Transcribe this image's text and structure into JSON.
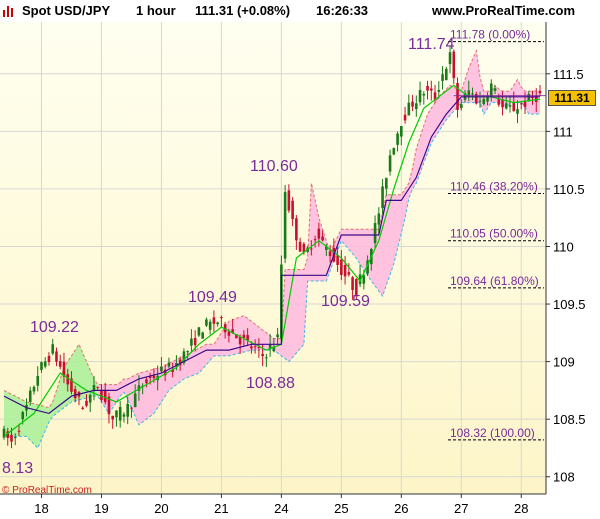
{
  "header": {
    "instrument": "Spot USD/JPY",
    "timeframe": "1 hour",
    "price_change": "111.31 (+0.08%)",
    "time": "16:26:33",
    "site": "www.ProRealTime.com"
  },
  "last_price_label": "111.31",
  "copyright": "© ProRealTime.com",
  "colors": {
    "plot_background_top": "#fffff0",
    "plot_background_bottom": "#fdf5c8",
    "candle_up": "#1a7a1a",
    "candle_down": "#c8102e",
    "fast_line": "#00cc00",
    "slow_line": "#3a0a8a",
    "cloud_bearish": "#ffb8e0",
    "cloud_bullish": "#a8f098",
    "annotation": "#7a2a9a",
    "last_price_box": "#f5c000"
  },
  "chart_data": {
    "type": "candlestick",
    "x_axis": {
      "tick_labels": [
        "18",
        "19",
        "20",
        "21",
        "24",
        "25",
        "26",
        "27",
        "28"
      ]
    },
    "y_axis": {
      "tick_labels": [
        "111.5",
        "111",
        "110.5",
        "110",
        "109.5",
        "109",
        "108.5",
        "108"
      ],
      "range": [
        107.85,
        111.95
      ]
    },
    "grid": true,
    "price_labels": [
      "109.22",
      "109.49",
      "108.88",
      "110.60",
      "109.59",
      "111.74",
      "8.13"
    ],
    "fibonacci_levels": [
      {
        "value": 111.78,
        "label": "111.78 (0.00%)"
      },
      {
        "value": 110.46,
        "label": "110.46 (38.20%)"
      },
      {
        "value": 110.05,
        "label": "110.05 (50.00%)"
      },
      {
        "value": 109.64,
        "label": "109.64 (61.80%)"
      },
      {
        "value": 108.32,
        "label": "108.32 (100.00)"
      }
    ],
    "price_path": [
      [
        0,
        108.4
      ],
      [
        3,
        108.3
      ],
      [
        7,
        108.6
      ],
      [
        10,
        108.9
      ],
      [
        14,
        109.1
      ],
      [
        18,
        108.8
      ],
      [
        22,
        108.6
      ],
      [
        26,
        108.8
      ],
      [
        30,
        108.5
      ],
      [
        34,
        108.6
      ],
      [
        38,
        108.8
      ],
      [
        42,
        108.9
      ],
      [
        46,
        108.95
      ],
      [
        50,
        109.1
      ],
      [
        54,
        109.3
      ],
      [
        58,
        109.35
      ],
      [
        62,
        109.25
      ],
      [
        66,
        109.15
      ],
      [
        70,
        109.05
      ],
      [
        74,
        109.2
      ],
      [
        76,
        110.5
      ],
      [
        78,
        110.2
      ],
      [
        81,
        109.9
      ],
      [
        84,
        110.1
      ],
      [
        88,
        109.95
      ],
      [
        92,
        109.75
      ],
      [
        95,
        109.62
      ],
      [
        98,
        109.9
      ],
      [
        101,
        110.3
      ],
      [
        104,
        110.8
      ],
      [
        107,
        111.1
      ],
      [
        110,
        111.25
      ],
      [
        113,
        111.35
      ],
      [
        116,
        111.3
      ],
      [
        118,
        111.5
      ],
      [
        120,
        111.65
      ],
      [
        122,
        111.2
      ],
      [
        125,
        111.35
      ],
      [
        128,
        111.25
      ],
      [
        131,
        111.4
      ],
      [
        134,
        111.2
      ],
      [
        137,
        111.2
      ],
      [
        140,
        111.25
      ],
      [
        143,
        111.31
      ]
    ],
    "series": [
      {
        "points": [
          [
            0,
            108.35
          ],
          [
            8,
            108.55
          ],
          [
            15,
            108.9
          ],
          [
            22,
            108.75
          ],
          [
            30,
            108.65
          ],
          [
            38,
            108.8
          ],
          [
            46,
            108.95
          ],
          [
            52,
            109.15
          ],
          [
            58,
            109.3
          ],
          [
            64,
            109.2
          ],
          [
            70,
            109.1
          ],
          [
            74,
            109.15
          ],
          [
            78,
            109.9
          ],
          [
            84,
            110.05
          ],
          [
            90,
            109.9
          ],
          [
            95,
            109.7
          ],
          [
            100,
            110.05
          ],
          [
            104,
            110.5
          ],
          [
            108,
            110.9
          ],
          [
            112,
            111.2
          ],
          [
            116,
            111.3
          ],
          [
            120,
            111.4
          ],
          [
            124,
            111.3
          ],
          [
            130,
            111.3
          ],
          [
            136,
            111.25
          ],
          [
            143,
            111.28
          ]
        ]
      },
      {
        "points": [
          [
            0,
            108.7
          ],
          [
            6,
            108.6
          ],
          [
            12,
            108.55
          ],
          [
            18,
            108.7
          ],
          [
            24,
            108.75
          ],
          [
            30,
            108.75
          ],
          [
            36,
            108.85
          ],
          [
            42,
            108.9
          ],
          [
            48,
            109.0
          ],
          [
            54,
            109.1
          ],
          [
            60,
            109.1
          ],
          [
            66,
            109.15
          ],
          [
            72,
            109.15
          ],
          [
            74,
            109.15
          ],
          [
            74,
            109.75
          ],
          [
            80,
            109.75
          ],
          [
            86,
            109.75
          ],
          [
            90,
            110.1
          ],
          [
            96,
            110.1
          ],
          [
            100,
            110.1
          ],
          [
            102,
            110.4
          ],
          [
            106,
            110.4
          ],
          [
            110,
            110.6
          ],
          [
            114,
            110.95
          ],
          [
            118,
            111.15
          ],
          [
            122,
            111.3
          ],
          [
            130,
            111.3
          ],
          [
            136,
            111.3
          ],
          [
            143,
            111.3
          ]
        ]
      }
    ]
  }
}
